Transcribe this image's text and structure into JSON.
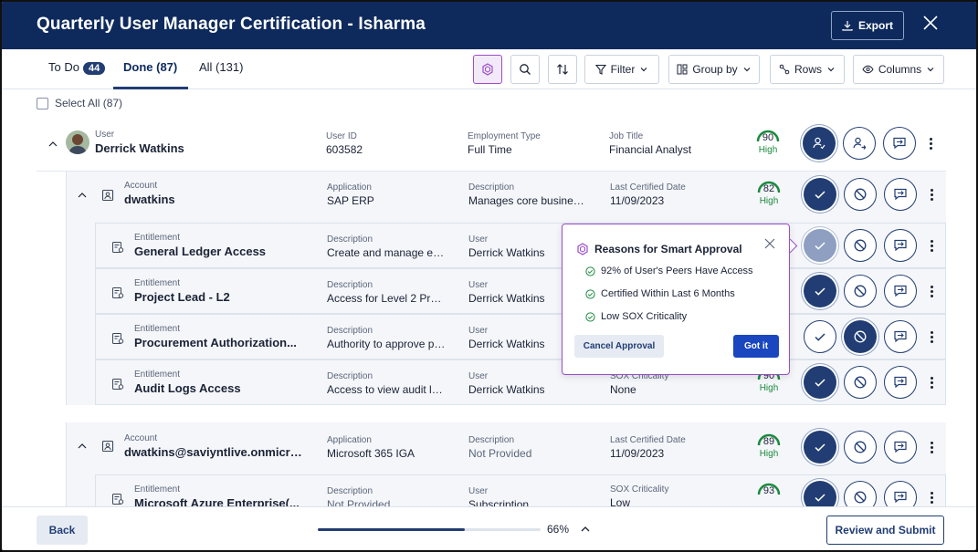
{
  "header": {
    "title": "Quarterly User Manager Certification - Isharma",
    "export_label": "Export"
  },
  "tabs": {
    "todo_label": "To Do",
    "todo_count": "44",
    "done_label": "Done (87)",
    "all_label": "All (131)"
  },
  "toolbar": {
    "filter_label": "Filter",
    "groupby_label": "Group by",
    "rows_label": "Rows",
    "columns_label": "Columns"
  },
  "select_all_label": "Select All (87)",
  "user": {
    "type_label": "User",
    "name": "Derrick Watkins",
    "id_label": "User ID",
    "id": "603582",
    "emp_label": "Employment Type",
    "emp": "Full Time",
    "job_label": "Job Title",
    "job": "Financial Analyst",
    "score": "90",
    "score_level": "High"
  },
  "account1": {
    "type_label": "Account",
    "name": "dwatkins",
    "app_label": "Application",
    "app": "SAP ERP",
    "desc_label": "Description",
    "desc": "Manages core business...",
    "date_label": "Last Certified Date",
    "date": "11/09/2023",
    "score": "82",
    "score_level": "High"
  },
  "entitlements": [
    {
      "type_label": "Entitlement",
      "name": "General Ledger Access",
      "desc_label": "Description",
      "desc": "Create and manage ent...",
      "user_label": "User",
      "user": "Derrick Watkins"
    },
    {
      "type_label": "Entitlement",
      "name": "Project Lead - L2",
      "desc_label": "Description",
      "desc": "Access for Level 2 Proj...",
      "user_label": "User",
      "user": "Derrick Watkins"
    },
    {
      "type_label": "Entitlement",
      "name": "Procurement Authorization...",
      "desc_label": "Description",
      "desc": "Authority to approve pu...",
      "user_label": "User",
      "user": "Derrick Watkins"
    },
    {
      "type_label": "Entitlement",
      "name": "Audit Logs Access",
      "desc_label": "Description",
      "desc": "Access to view audit lo...",
      "user_label": "User",
      "user": "Derrick Watkins",
      "sox_label": "SOX Criticality",
      "sox": "None",
      "score": "90",
      "score_level": "High"
    }
  ],
  "account2": {
    "type_label": "Account",
    "name": "dwatkins@saviyntlive.onmicro...",
    "app_label": "Application",
    "app": "Microsoft 365 IGA",
    "desc_label": "Description",
    "desc": "Not Provided",
    "date_label": "Last Certified Date",
    "date": "11/09/2023",
    "score": "89",
    "score_level": "High"
  },
  "entitlement5": {
    "type_label": "Entitlement",
    "name": "Microsoft Azure Enterprise(...",
    "desc_label": "Description",
    "desc": "Not Provided",
    "user_label": "User",
    "user": "Subscription",
    "sox_label": "SOX Criticality",
    "sox": "Low",
    "score": "93"
  },
  "popover": {
    "title": "Reasons for Smart Approval",
    "reasons": [
      "92% of User's Peers Have Access",
      "Certified Within Last 6 Months",
      "Low SOX Criticality"
    ],
    "cancel_label": "Cancel Approval",
    "ok_label": "Got it"
  },
  "footer": {
    "back_label": "Back",
    "progress_pct": "66%",
    "progress_value": 0.66,
    "submit_label": "Review and Submit"
  },
  "colors": {
    "header_bg": "#0e2a5c",
    "accent": "#213d73",
    "ai_purple": "#9b4dca",
    "high_green": "#1a8a3d"
  }
}
